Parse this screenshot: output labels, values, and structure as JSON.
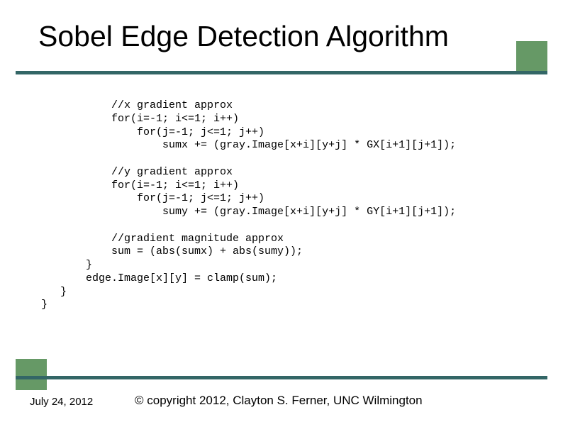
{
  "title": "Sobel Edge Detection Algorithm",
  "code": "           //x gradient approx\n           for(i=-1; i<=1; i++)\n               for(j=-1; j<=1; j++)\n                   sumx += (gray.Image[x+i][y+j] * GX[i+1][j+1]);\n\n           //y gradient approx\n           for(i=-1; i<=1; i++)\n               for(j=-1; j<=1; j++)\n                   sumy += (gray.Image[x+i][y+j] * GY[i+1][j+1]);\n\n           //gradient magnitude approx\n           sum = (abs(sumx) + abs(sumy));\n       }\n       edge.Image[x][y] = clamp(sum);\n   }\n}",
  "footer": {
    "date": "July 24, 2012",
    "copyright": "© copyright 2012, Clayton S. Ferner, UNC Wilmington"
  }
}
